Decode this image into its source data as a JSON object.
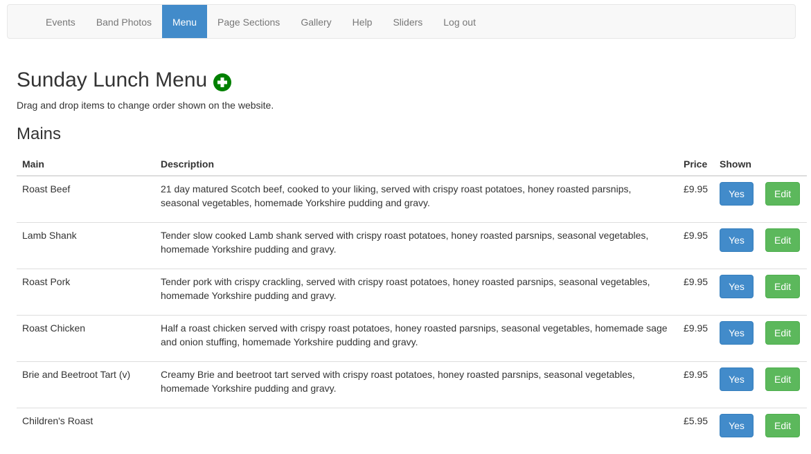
{
  "nav": {
    "items": [
      {
        "label": "Events",
        "active": false
      },
      {
        "label": "Band Photos",
        "active": false
      },
      {
        "label": "Menu",
        "active": true
      },
      {
        "label": "Page Sections",
        "active": false
      },
      {
        "label": "Gallery",
        "active": false
      },
      {
        "label": "Help",
        "active": false
      },
      {
        "label": "Sliders",
        "active": false
      },
      {
        "label": "Log out",
        "active": false
      }
    ]
  },
  "page": {
    "title": "Sunday Lunch Menu",
    "hint": "Drag and drop items to change order shown on the website.",
    "add_icon": "plus-circle-icon",
    "add_icon_color": "#008000"
  },
  "section": {
    "title": "Mains",
    "columns": [
      "Main",
      "Description",
      "Price",
      "Shown"
    ],
    "rows": [
      {
        "name": "Roast Beef",
        "description": "21 day matured Scotch beef, cooked to your liking, served with crispy roast potatoes, honey roasted parsnips, seasonal vegetables, homemade Yorkshire pudding and gravy.",
        "price": "£9.95",
        "shown": "Yes",
        "edit": "Edit"
      },
      {
        "name": "Lamb Shank",
        "description": "Tender slow cooked Lamb shank served with crispy roast potatoes, honey roasted parsnips, seasonal vegetables, homemade Yorkshire pudding and gravy.",
        "price": "£9.95",
        "shown": "Yes",
        "edit": "Edit"
      },
      {
        "name": "Roast Pork",
        "description": "Tender pork with crispy crackling, served with crispy roast potatoes, honey roasted parsnips, seasonal vegetables, homemade Yorkshire pudding and gravy.",
        "price": "£9.95",
        "shown": "Yes",
        "edit": "Edit"
      },
      {
        "name": "Roast Chicken",
        "description": "Half a roast chicken served with crispy roast potatoes, honey roasted parsnips, seasonal vegetables, homemade sage and onion stuffing, homemade Yorkshire pudding and gravy.",
        "price": "£9.95",
        "shown": "Yes",
        "edit": "Edit"
      },
      {
        "name": "Brie and Beetroot Tart (v)",
        "description": "Creamy Brie and beetroot tart served with crispy roast potatoes, honey roasted parsnips, seasonal vegetables, homemade Yorkshire pudding and gravy.",
        "price": "£9.95",
        "shown": "Yes",
        "edit": "Edit"
      },
      {
        "name": "Children's Roast",
        "description": "",
        "price": "£5.95",
        "shown": "Yes",
        "edit": "Edit"
      }
    ]
  }
}
